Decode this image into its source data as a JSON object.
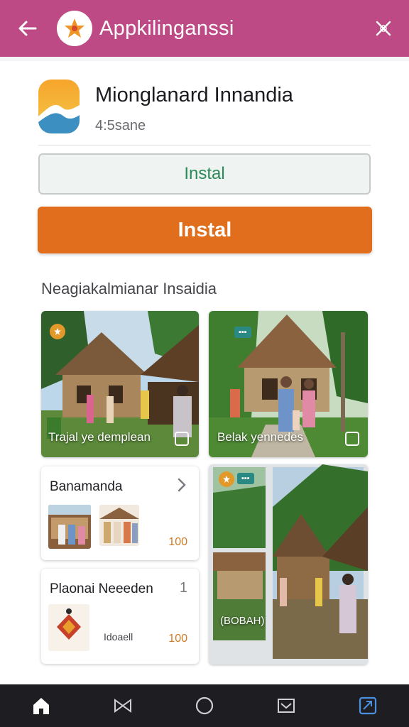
{
  "topbar": {
    "title": "Appkilinganssi",
    "back_icon": "arrow-left-icon",
    "close_icon": "close-icon",
    "background": "#bd4a84"
  },
  "app": {
    "name": "Mionglanard Innandia",
    "rating": "4:5sane"
  },
  "buttons": {
    "outline_label": "Instal",
    "primary_label": "Instal",
    "primary_color": "#e16e1d"
  },
  "section": {
    "title": "Neagiakalmianar Insaidia"
  },
  "photos": [
    {
      "caption": "Trajal ye demplean"
    },
    {
      "caption": "Belak yennedes"
    },
    {
      "caption": "(BOBAH)"
    }
  ],
  "lists": [
    {
      "title": "Banamanda",
      "count": "100"
    },
    {
      "title": "Plaonai Neeeden",
      "badge": "1",
      "meta": "Idoaell",
      "count": "100"
    }
  ],
  "bottom_nav": [
    {
      "icon": "home-icon"
    },
    {
      "icon": "bowtie-icon"
    },
    {
      "icon": "circle-icon"
    },
    {
      "icon": "inbox-icon"
    },
    {
      "icon": "recent-apps-icon"
    }
  ]
}
